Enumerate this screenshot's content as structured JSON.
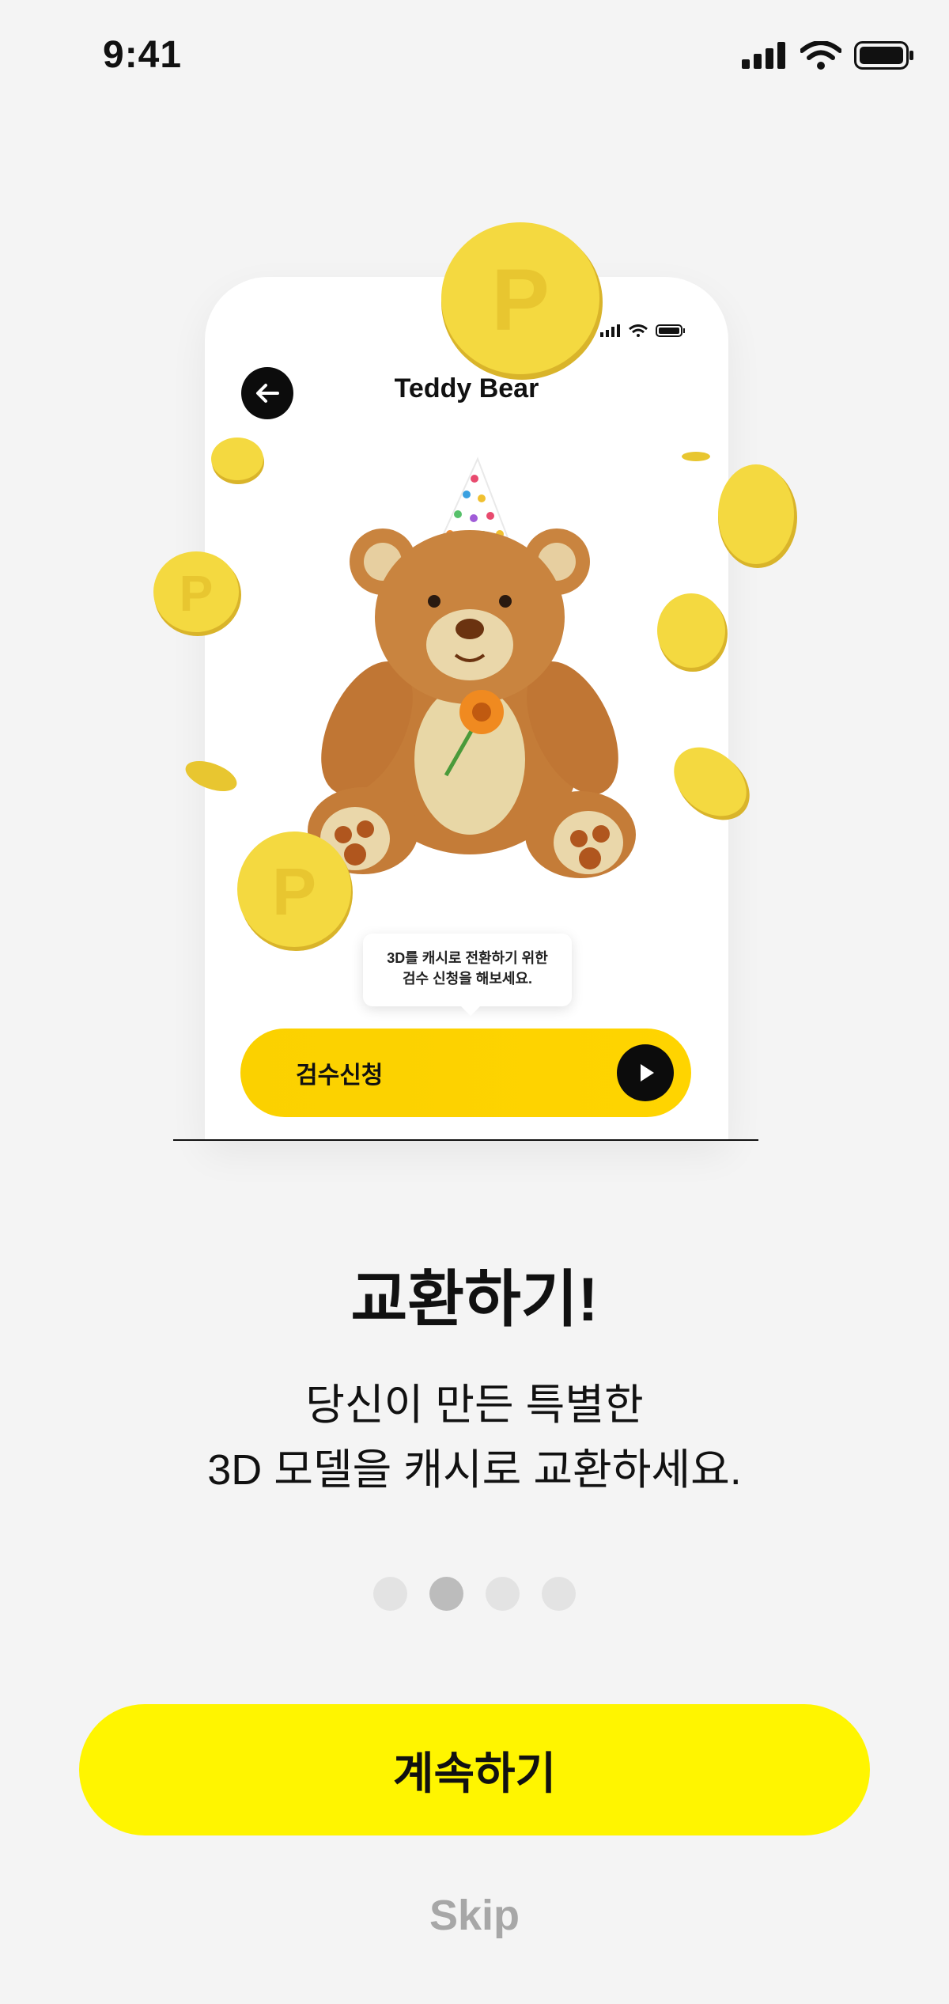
{
  "status_bar": {
    "time": "9:41",
    "icons": [
      "signal-icon",
      "wifi-icon",
      "battery-icon"
    ]
  },
  "mockup": {
    "title": "Teddy Bear",
    "back_icon": "arrow-left-icon",
    "tooltip": {
      "line1": "3D를 캐시로 전환하기 위한",
      "line2": "검수 신청을 해보세요."
    },
    "cta_label": "검수신청",
    "cta_icon": "play-icon",
    "illustration": "teddy-bear-with-party-hat"
  },
  "headline": "교환하기!",
  "subtitle": {
    "line1": "당신이 만든 특별한",
    "line2": "3D 모델을 캐시로 교환하세요."
  },
  "pagination": {
    "total": 4,
    "current": 2
  },
  "continue_label": "계속하기",
  "skip_label": "Skip",
  "colors": {
    "primary_yellow": "#fff500",
    "cta_yellow": "#ffd400",
    "coin_yellow": "#f2d43c",
    "background": "#f4f4f4"
  }
}
